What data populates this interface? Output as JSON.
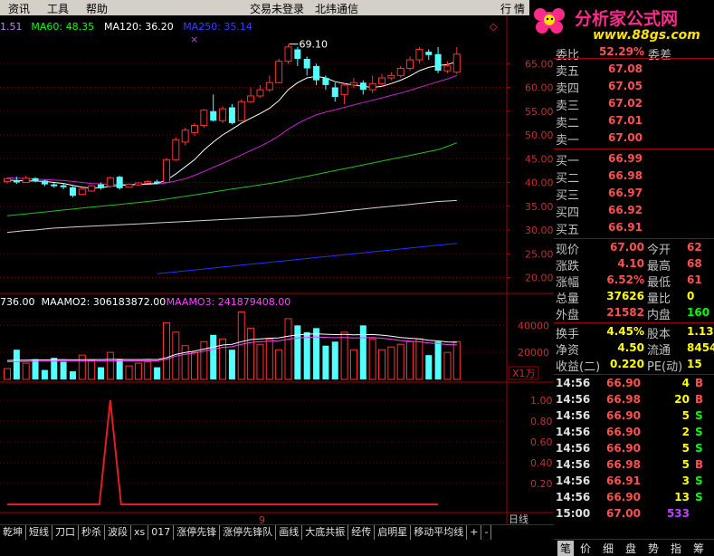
{
  "menu": {
    "items": [
      "资讯",
      "工具",
      "帮助"
    ],
    "center1": "交易未登录",
    "center2": "北纬通信",
    "right1": "行",
    "right2": "情"
  },
  "logo": {
    "line1": "分析家公式网",
    "line2": "www.88gs.com"
  },
  "indicators": {
    "ma": [
      {
        "label": "1.51",
        "color": "#c080ff"
      },
      {
        "label": "MA60: 48.35",
        "color": "#00ff00"
      },
      {
        "label": "MA120: 36.20",
        "color": "#ffffff"
      },
      {
        "label": "MA250: 35.14",
        "color": "#3040ff"
      }
    ],
    "vol": [
      {
        "label": "736.00",
        "color": "#ffffff"
      },
      {
        "label": "MAAMO2: 306183872.00",
        "color": "#ffffff"
      },
      {
        "label": "MAAMO3: 241879408.00",
        "color": "#ff40ff"
      }
    ],
    "peak_label": "69.10",
    "vol_unit": "X1万",
    "bottom_x": "9",
    "period": "日线"
  },
  "price_axis": [
    "65.00",
    "60.00",
    "55.00",
    "50.00",
    "45.00",
    "40.00",
    "35.00",
    "30.00",
    "25.00",
    "20.00"
  ],
  "vol_axis": [
    "40000",
    "20000"
  ],
  "ind_axis": [
    "1.00",
    "0.80",
    "0.60",
    "0.40",
    "0.20"
  ],
  "chart_data": {
    "type": "candlestick",
    "candles": [
      {
        "o": 40.2,
        "c": 40.8,
        "h": 41.0,
        "l": 39.8
      },
      {
        "o": 40.5,
        "c": 40.0,
        "h": 41.2,
        "l": 39.7
      },
      {
        "o": 40.0,
        "c": 40.9,
        "h": 41.4,
        "l": 39.9
      },
      {
        "o": 40.9,
        "c": 40.3,
        "h": 41.1,
        "l": 40.0
      },
      {
        "o": 40.4,
        "c": 39.6,
        "h": 40.6,
        "l": 39.2
      },
      {
        "o": 39.6,
        "c": 39.2,
        "h": 40.0,
        "l": 38.9
      },
      {
        "o": 39.4,
        "c": 39.0,
        "h": 39.8,
        "l": 38.6
      },
      {
        "o": 39.0,
        "c": 37.2,
        "h": 39.2,
        "l": 36.9
      },
      {
        "o": 37.5,
        "c": 38.6,
        "h": 38.9,
        "l": 37.3
      },
      {
        "o": 38.2,
        "c": 39.3,
        "h": 39.5,
        "l": 38.0
      },
      {
        "o": 39.6,
        "c": 38.8,
        "h": 40.0,
        "l": 38.5
      },
      {
        "o": 39.2,
        "c": 41.0,
        "h": 41.2,
        "l": 39.0
      },
      {
        "o": 41.2,
        "c": 38.8,
        "h": 41.4,
        "l": 38.5
      },
      {
        "o": 39.0,
        "c": 39.6,
        "h": 39.8,
        "l": 38.9
      },
      {
        "o": 39.5,
        "c": 39.9,
        "h": 40.1,
        "l": 39.3
      },
      {
        "o": 39.9,
        "c": 40.2,
        "h": 40.5,
        "l": 39.8
      },
      {
        "o": 40.2,
        "c": 39.8,
        "h": 40.6,
        "l": 39.6
      },
      {
        "o": 40.0,
        "c": 44.8,
        "h": 45.2,
        "l": 39.9
      },
      {
        "o": 44.8,
        "c": 49.0,
        "h": 49.5,
        "l": 44.5
      },
      {
        "o": 48.5,
        "c": 51.0,
        "h": 51.5,
        "l": 47.8
      },
      {
        "o": 50.5,
        "c": 52.0,
        "h": 52.5,
        "l": 49.8
      },
      {
        "o": 52.0,
        "c": 55.2,
        "h": 55.5,
        "l": 51.5
      },
      {
        "o": 55.0,
        "c": 53.0,
        "h": 58.5,
        "l": 52.8
      },
      {
        "o": 53.0,
        "c": 55.5,
        "h": 56.0,
        "l": 52.5
      },
      {
        "o": 55.8,
        "c": 52.5,
        "h": 56.5,
        "l": 52.2
      },
      {
        "o": 53.0,
        "c": 57.0,
        "h": 57.5,
        "l": 52.8
      },
      {
        "o": 57.0,
        "c": 58.2,
        "h": 60.0,
        "l": 56.8
      },
      {
        "o": 58.2,
        "c": 59.5,
        "h": 60.5,
        "l": 57.8
      },
      {
        "o": 59.5,
        "c": 61.0,
        "h": 62.5,
        "l": 59.0
      },
      {
        "o": 61.0,
        "c": 65.5,
        "h": 66.0,
        "l": 60.8
      },
      {
        "o": 65.5,
        "c": 68.5,
        "h": 69.1,
        "l": 65.0
      },
      {
        "o": 68.0,
        "c": 66.0,
        "h": 68.5,
        "l": 64.5
      },
      {
        "o": 66.0,
        "c": 64.0,
        "h": 66.5,
        "l": 62.5
      },
      {
        "o": 64.5,
        "c": 61.5,
        "h": 65.0,
        "l": 60.5
      },
      {
        "o": 62.0,
        "c": 60.5,
        "h": 62.5,
        "l": 59.5
      },
      {
        "o": 60.0,
        "c": 58.0,
        "h": 61.0,
        "l": 57.0
      },
      {
        "o": 58.5,
        "c": 60.5,
        "h": 61.0,
        "l": 56.5
      },
      {
        "o": 60.5,
        "c": 61.0,
        "h": 62.0,
        "l": 59.8
      },
      {
        "o": 61.0,
        "c": 59.5,
        "h": 61.5,
        "l": 58.5
      },
      {
        "o": 59.5,
        "c": 60.8,
        "h": 62.5,
        "l": 58.8
      },
      {
        "o": 60.8,
        "c": 62.0,
        "h": 62.8,
        "l": 60.2
      },
      {
        "o": 62.0,
        "c": 62.5,
        "h": 63.2,
        "l": 61.5
      },
      {
        "o": 62.5,
        "c": 64.0,
        "h": 64.5,
        "l": 62.0
      },
      {
        "o": 64.0,
        "c": 65.8,
        "h": 66.5,
        "l": 63.5
      },
      {
        "o": 65.8,
        "c": 68.0,
        "h": 68.5,
        "l": 65.0
      },
      {
        "o": 67.5,
        "c": 66.8,
        "h": 68.0,
        "l": 65.8
      },
      {
        "o": 67.0,
        "c": 63.5,
        "h": 68.5,
        "l": 63.0
      },
      {
        "o": 63.5,
        "c": 64.5,
        "h": 65.5,
        "l": 63.0
      },
      {
        "o": 63.2,
        "c": 67.0,
        "h": 68.5,
        "l": 62.8
      }
    ],
    "ma_white": [
      40.5,
      40.4,
      40.3,
      40.3,
      40.2,
      40.0,
      39.8,
      39.4,
      39.0,
      38.8,
      38.9,
      39.2,
      39.4,
      39.5,
      39.6,
      39.7,
      39.8,
      40.5,
      41.8,
      43.3,
      44.8,
      46.8,
      48.5,
      50.0,
      51.2,
      52.5,
      53.5,
      54.5,
      55.6,
      57.2,
      59.5,
      61.0,
      62.0,
      62.3,
      62.0,
      61.2,
      60.8,
      60.5,
      60.2,
      60.0,
      60.2,
      60.8,
      61.5,
      62.4,
      63.5,
      64.2,
      64.6,
      64.8,
      65.4
    ],
    "ma_magenta": [
      41.0,
      40.9,
      40.8,
      40.7,
      40.6,
      40.5,
      40.4,
      40.2,
      40.0,
      39.8,
      39.7,
      39.6,
      39.6,
      39.6,
      39.6,
      39.6,
      39.7,
      39.9,
      40.3,
      40.8,
      41.5,
      42.3,
      43.2,
      44.0,
      44.9,
      45.8,
      46.7,
      47.6,
      48.6,
      49.8,
      51.2,
      52.4,
      53.4,
      54.2,
      54.8,
      55.3,
      55.8,
      56.3,
      56.8,
      57.3,
      57.8,
      58.3,
      58.8,
      59.4,
      60.0,
      60.6,
      61.2,
      61.8,
      62.5
    ],
    "ma60": [
      33.0,
      33.2,
      33.4,
      33.6,
      33.8,
      34.0,
      34.2,
      34.4,
      34.6,
      34.8,
      35.0,
      35.2,
      35.4,
      35.6,
      35.8,
      36.0,
      36.2,
      36.5,
      36.8,
      37.1,
      37.4,
      37.7,
      38.0,
      38.3,
      38.6,
      38.9,
      39.2,
      39.5,
      39.8,
      40.1,
      40.5,
      40.9,
      41.3,
      41.7,
      42.1,
      42.5,
      42.9,
      43.3,
      43.7,
      44.1,
      44.5,
      44.9,
      45.3,
      45.7,
      46.1,
      46.5,
      46.9,
      47.6,
      48.35
    ],
    "ma120": [
      29.5,
      29.7,
      29.9,
      30.0,
      30.2,
      30.4,
      30.5,
      30.6,
      30.7,
      30.8,
      30.9,
      31.0,
      31.1,
      31.2,
      31.3,
      31.4,
      31.5,
      31.6,
      31.7,
      31.8,
      31.9,
      32.0,
      32.1,
      32.2,
      32.3,
      32.4,
      32.5,
      32.6,
      32.7,
      32.8,
      32.9,
      33.0,
      33.2,
      33.4,
      33.6,
      33.8,
      34.0,
      34.2,
      34.4,
      34.6,
      34.8,
      35.0,
      35.2,
      35.4,
      35.6,
      35.8,
      36.0,
      36.1,
      36.2
    ],
    "ma250": [
      null,
      null,
      null,
      null,
      null,
      null,
      null,
      null,
      null,
      null,
      null,
      null,
      null,
      null,
      null,
      null,
      20.8,
      21.0,
      21.2,
      21.4,
      21.6,
      21.8,
      22.0,
      22.2,
      22.4,
      22.6,
      22.8,
      23.0,
      23.2,
      23.4,
      23.6,
      23.8,
      24.0,
      24.2,
      24.4,
      24.6,
      24.8,
      25.0,
      25.2,
      25.4,
      25.6,
      25.8,
      26.0,
      26.2,
      26.4,
      26.6,
      26.8,
      27.0,
      27.2
    ],
    "volumes": [
      8000,
      22000,
      12000,
      15000,
      7000,
      16000,
      13000,
      6000,
      18000,
      14000,
      9000,
      20000,
      15000,
      10000,
      12000,
      13000,
      9000,
      42000,
      35000,
      25000,
      20000,
      28000,
      33000,
      30000,
      22000,
      50000,
      38000,
      26000,
      30000,
      22000,
      45000,
      40000,
      35000,
      38000,
      25000,
      28000,
      35000,
      22000,
      40000,
      30000,
      22000,
      24000,
      26000,
      28000,
      30000,
      18000,
      28000,
      20000,
      28000
    ],
    "vol_ma": [
      14000,
      14200,
      14300,
      14500,
      14500,
      14600,
      14700,
      14500,
      14600,
      14700,
      14700,
      14800,
      14800,
      14700,
      14700,
      14800,
      14700,
      16000,
      18500,
      20000,
      21000,
      22500,
      24000,
      25500,
      26000,
      28000,
      29500,
      30000,
      30500,
      30800,
      32000,
      33000,
      33500,
      33800,
      33500,
      33200,
      33400,
      33000,
      33200,
      33300,
      32800,
      32000,
      31000,
      30500,
      30000,
      29000,
      28500,
      27800,
      27500
    ],
    "signal": {
      "x": [
        0,
        46
      ],
      "peak_index": 12,
      "peak_value": 1.0
    }
  },
  "panel": {
    "weibi": {
      "label": "委比",
      "value": "52.29%",
      "label2": "委差"
    },
    "asks": [
      {
        "label": "卖五",
        "price": "67.08"
      },
      {
        "label": "卖四",
        "price": "67.05"
      },
      {
        "label": "卖三",
        "price": "67.02"
      },
      {
        "label": "卖二",
        "price": "67.01"
      },
      {
        "label": "卖一",
        "price": "67.00"
      }
    ],
    "bids": [
      {
        "label": "买一",
        "price": "66.99"
      },
      {
        "label": "买二",
        "price": "66.98"
      },
      {
        "label": "买三",
        "price": "66.97"
      },
      {
        "label": "买四",
        "price": "66.92"
      },
      {
        "label": "买五",
        "price": "66.91"
      }
    ],
    "stats": [
      {
        "l1": "现价",
        "v1": "67.00",
        "c1": "#ff5050",
        "l2": "今开",
        "v2": "62",
        "c2": "#ff5050"
      },
      {
        "l1": "涨跌",
        "v1": "4.10",
        "c1": "#ff5050",
        "l2": "最高",
        "v2": "68",
        "c2": "#ff5050"
      },
      {
        "l1": "涨幅",
        "v1": "6.52%",
        "c1": "#ff5050",
        "l2": "最低",
        "v2": "61",
        "c2": "#ff5050"
      },
      {
        "l1": "总量",
        "v1": "37626",
        "c1": "#ffff00",
        "l2": "量比",
        "v2": "0",
        "c2": "#ffff00"
      },
      {
        "l1": "外盘",
        "v1": "21582",
        "c1": "#ff5050",
        "l2": "内盘",
        "v2": "160",
        "c2": "#00ff00"
      }
    ],
    "stats2": [
      {
        "l1": "换手",
        "v1": "4.45%",
        "c1": "#ffff00",
        "l2": "股本",
        "v2": "1.13",
        "c2": "#ffff00"
      },
      {
        "l1": "净资",
        "v1": "4.50",
        "c1": "#ffff00",
        "l2": "流通",
        "v2": "8454",
        "c2": "#ffff00"
      },
      {
        "l1": "收益(二)",
        "v1": "0.220",
        "c1": "#ffff00",
        "l2": "PE(动)",
        "v2": "15",
        "c2": "#ffff00"
      }
    ],
    "ticks": [
      {
        "time": "14:56",
        "price": "66.90",
        "vol": "4",
        "bs": "B"
      },
      {
        "time": "14:56",
        "price": "66.98",
        "vol": "20",
        "bs": "B"
      },
      {
        "time": "14:56",
        "price": "66.90",
        "vol": "5",
        "bs": "S"
      },
      {
        "time": "14:56",
        "price": "66.90",
        "vol": "2",
        "bs": "S"
      },
      {
        "time": "14:56",
        "price": "66.90",
        "vol": "5",
        "bs": "S"
      },
      {
        "time": "14:56",
        "price": "66.98",
        "vol": "5",
        "bs": "B"
      },
      {
        "time": "14:56",
        "price": "66.91",
        "vol": "3",
        "bs": "S"
      },
      {
        "time": "14:56",
        "price": "66.90",
        "vol": "13",
        "bs": "S"
      },
      {
        "time": "15:00",
        "price": "67.00",
        "vol": "533",
        "bs": ""
      }
    ]
  },
  "tabs": [
    "乾坤",
    "短线",
    "刀口",
    "秒杀",
    "波段",
    "xs",
    "017",
    "涨停先锋",
    "涨停先锋队",
    "画线",
    "大底共振",
    "经传",
    "启明星",
    "移动平均线"
  ],
  "tab_extra": [
    "+",
    "-"
  ],
  "side_tabs": [
    "笔",
    "价",
    "细",
    "盘",
    "势",
    "指",
    "筹"
  ]
}
